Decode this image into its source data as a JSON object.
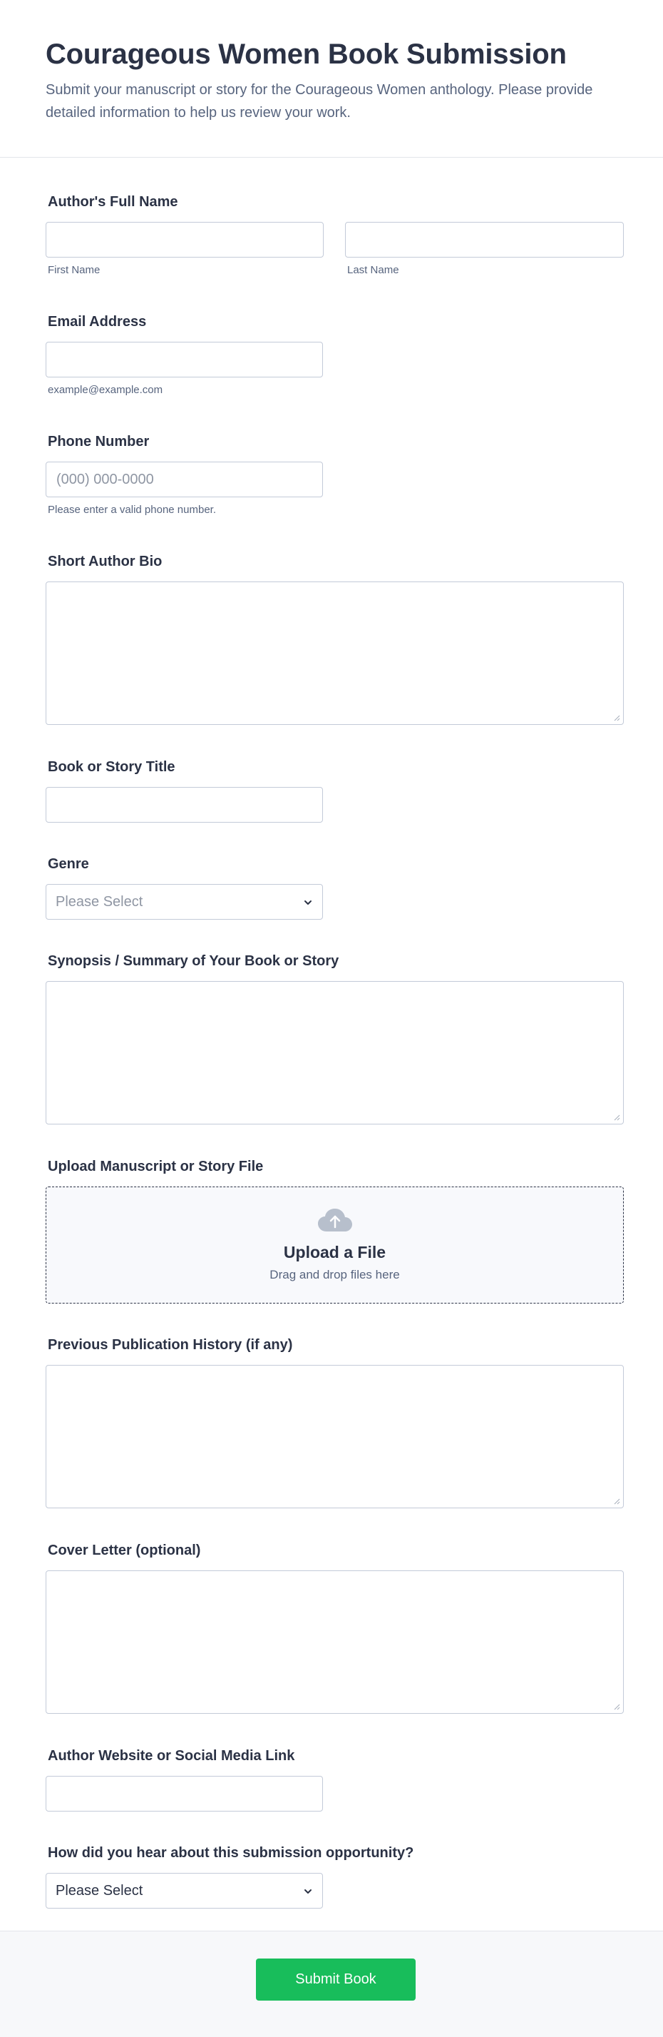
{
  "header": {
    "title": "Courageous Women Book Submission",
    "subtitle": "Submit your manuscript or story for the Courageous Women anthology. Please provide detailed information to help us review your work."
  },
  "fields": {
    "author_name": {
      "label": "Author's Full Name",
      "first_sublabel": "First Name",
      "last_sublabel": "Last Name",
      "first_value": "",
      "last_value": ""
    },
    "email": {
      "label": "Email Address",
      "sublabel": "example@example.com",
      "value": ""
    },
    "phone": {
      "label": "Phone Number",
      "placeholder": "(000) 000-0000",
      "sublabel": "Please enter a valid phone number.",
      "value": ""
    },
    "bio": {
      "label": "Short Author Bio"
    },
    "title": {
      "label": "Book or Story Title",
      "value": ""
    },
    "genre": {
      "label": "Genre",
      "selected": "Please Select"
    },
    "synopsis": {
      "label": "Synopsis / Summary of Your Book or Story"
    },
    "upload": {
      "label": "Upload Manuscript or Story File",
      "title": "Upload a File",
      "subtitle": "Drag and drop files here"
    },
    "publication_history": {
      "label": "Previous Publication History (if any)"
    },
    "cover_letter": {
      "label": "Cover Letter (optional)"
    },
    "website": {
      "label": "Author Website or Social Media Link",
      "value": ""
    },
    "referral": {
      "label": "How did you hear about this submission opportunity?",
      "selected": "Please Select"
    }
  },
  "footer": {
    "submit_label": "Submit Book"
  },
  "colors": {
    "accent": "#18bd5b",
    "text": "#2b3245",
    "muted": "#57647e",
    "border": "#c3cad8",
    "placeholder": "#8f96a3"
  }
}
